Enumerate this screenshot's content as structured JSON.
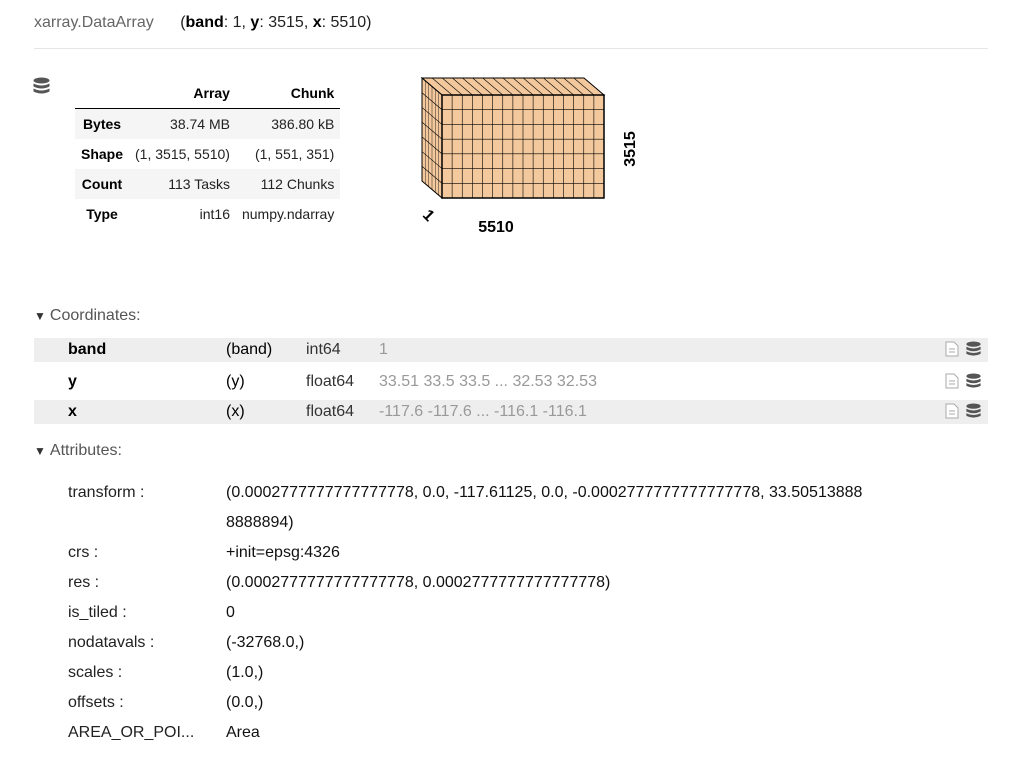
{
  "header": {
    "class_name": "xarray.DataArray",
    "dims": [
      {
        "name": "band",
        "size": "1"
      },
      {
        "name": "y",
        "size": "3515"
      },
      {
        "name": "x",
        "size": "5510"
      }
    ]
  },
  "summary": {
    "col_headers": [
      "Array",
      "Chunk"
    ],
    "rows": [
      {
        "label": "Bytes",
        "array": "38.74 MB",
        "chunk": "386.80 kB"
      },
      {
        "label": "Shape",
        "array": "(1, 3515, 5510)",
        "chunk": "(1, 551, 351)"
      },
      {
        "label": "Count",
        "array": "113 Tasks",
        "chunk": "112 Chunks"
      },
      {
        "label": "Type",
        "array": "int16",
        "chunk": "numpy.ndarray"
      }
    ]
  },
  "chunk_diagram": {
    "label_x": "5510",
    "label_y": "3515",
    "label_depth": "1",
    "fill_color": "#ECB172"
  },
  "coordinates": {
    "title": "Coordinates:",
    "rows": [
      {
        "name": "band",
        "dims": "(band)",
        "dtype": "int64",
        "preview": "1"
      },
      {
        "name": "y",
        "dims": "(y)",
        "dtype": "float64",
        "preview": "33.51 33.5 33.5 ... 32.53 32.53"
      },
      {
        "name": "x",
        "dims": "(x)",
        "dtype": "float64",
        "preview": "-117.6 -117.6 ... -116.1 -116.1"
      }
    ]
  },
  "attributes": {
    "title": "Attributes:",
    "rows": [
      {
        "key": "transform :",
        "value": "(0.0002777777777777778, 0.0, -117.61125, 0.0, -0.0002777777777777778, 33.505138888888894)"
      },
      {
        "key": "crs :",
        "value": "+init=epsg:4326"
      },
      {
        "key": "res :",
        "value": "(0.0002777777777777778, 0.0002777777777777778)"
      },
      {
        "key": "is_tiled :",
        "value": "0"
      },
      {
        "key": "nodatavals :",
        "value": "(-32768.0,)"
      },
      {
        "key": "scales :",
        "value": "(1.0,)"
      },
      {
        "key": "offsets :",
        "value": "(0.0,)"
      },
      {
        "key": "AREA_OR_POI...",
        "value": "Area"
      }
    ]
  }
}
